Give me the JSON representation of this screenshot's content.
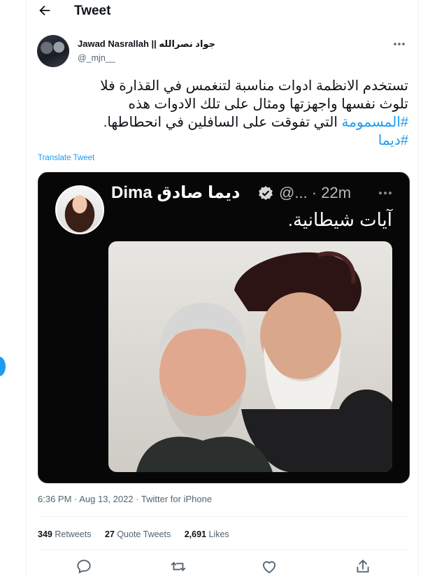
{
  "header": {
    "title": "Tweet"
  },
  "author": {
    "name": "Jawad Nasrallah || جواد نصرالله",
    "handle": "@_mjn__"
  },
  "tweet": {
    "lines": [
      "تستخدم الانظمة ادوات مناسبة لتنغمس في القذارة فلا",
      "تلوث نفسها واجهزتها ومثال على تلك الادوات هذه"
    ],
    "line3_text": " التي تفوقت على السافلين في انحطاطها.",
    "hashtag1": "#المسمومة",
    "hashtag2": "#ديما",
    "translate_label": "Translate Tweet"
  },
  "media": {
    "quoted_name": "Dima ديما صادق",
    "quoted_meta": "@... · 22m",
    "quoted_text": "آيات شيطانية."
  },
  "timestamp": "6:36 PM · Aug 13, 2022 · Twitter for iPhone",
  "stats": {
    "retweets_count": "349",
    "retweets_label": "Retweets",
    "quotes_count": "27",
    "quotes_label": "Quote Tweets",
    "likes_count": "2,691",
    "likes_label": "Likes"
  },
  "icons": {
    "back": "arrow-left-icon",
    "more": "more-horizontal-icon",
    "verified": "verified-badge-icon",
    "reply": "reply-icon",
    "retweet": "retweet-icon",
    "like": "heart-icon",
    "share": "share-icon"
  },
  "colors": {
    "accent": "#1d9bf0",
    "muted": "#536471",
    "text": "#0f1419"
  }
}
